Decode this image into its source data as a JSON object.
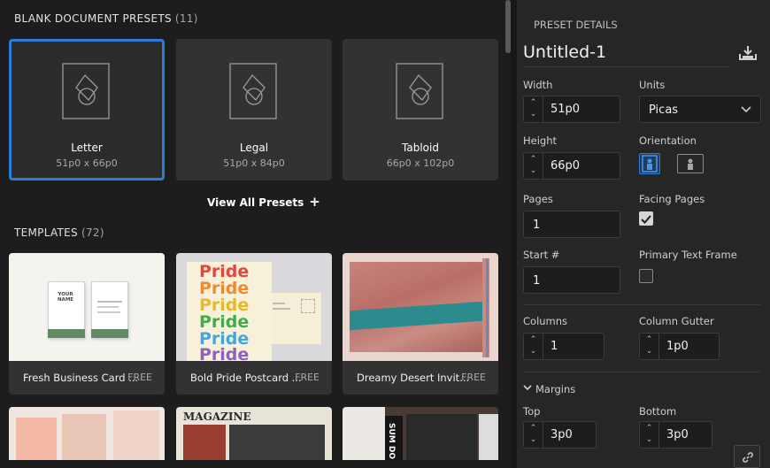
{
  "presets_section": {
    "title": "BLANK DOCUMENT PRESETS",
    "count": "(11)"
  },
  "presets": [
    {
      "name": "Letter",
      "size": "51p0 x 66p0",
      "selected": true
    },
    {
      "name": "Legal",
      "size": "51p0 x 84p0",
      "selected": false
    },
    {
      "name": "Tabloid",
      "size": "66p0 x 102p0",
      "selected": false
    }
  ],
  "view_all": {
    "label": "View All Presets",
    "icon": "plus-icon"
  },
  "templates_section": {
    "title": "TEMPLATES",
    "count": "(72)"
  },
  "templates": [
    {
      "name": "Fresh Business Card ...",
      "price": "FREE"
    },
    {
      "name": "Bold Pride Postcard ...",
      "price": "FREE"
    },
    {
      "name": "Dreamy Desert Invit...",
      "price": "FREE"
    }
  ],
  "template_thumb_text": {
    "card_name": "YOUR NAME",
    "pride_word": "Pride",
    "magazine_word": "MAGAZINE",
    "sum_do": "SUM DO"
  },
  "details": {
    "header": "PRESET DETAILS",
    "doc_name": "Untitled-1",
    "save_icon": "download-icon",
    "width_label": "Width",
    "width_value": "51p0",
    "units_label": "Units",
    "units_value": "Picas",
    "height_label": "Height",
    "height_value": "66p0",
    "orientation_label": "Orientation",
    "orientation_value": "portrait",
    "pages_label": "Pages",
    "pages_value": "1",
    "facing_label": "Facing Pages",
    "facing_checked": true,
    "start_label": "Start #",
    "start_value": "1",
    "ptf_label": "Primary Text Frame",
    "ptf_checked": false,
    "columns_label": "Columns",
    "columns_value": "1",
    "gutter_label": "Column Gutter",
    "gutter_value": "1p0",
    "margins_label": "Margins",
    "top_label": "Top",
    "top_value": "3p0",
    "bottom_label": "Bottom",
    "bottom_value": "3p0"
  },
  "colors": {
    "accent": "#2d7bd9",
    "pride": [
      "#e8453c",
      "#f08a2c",
      "#f3c530",
      "#3fae49",
      "#41a6e0",
      "#8b62c4"
    ]
  }
}
